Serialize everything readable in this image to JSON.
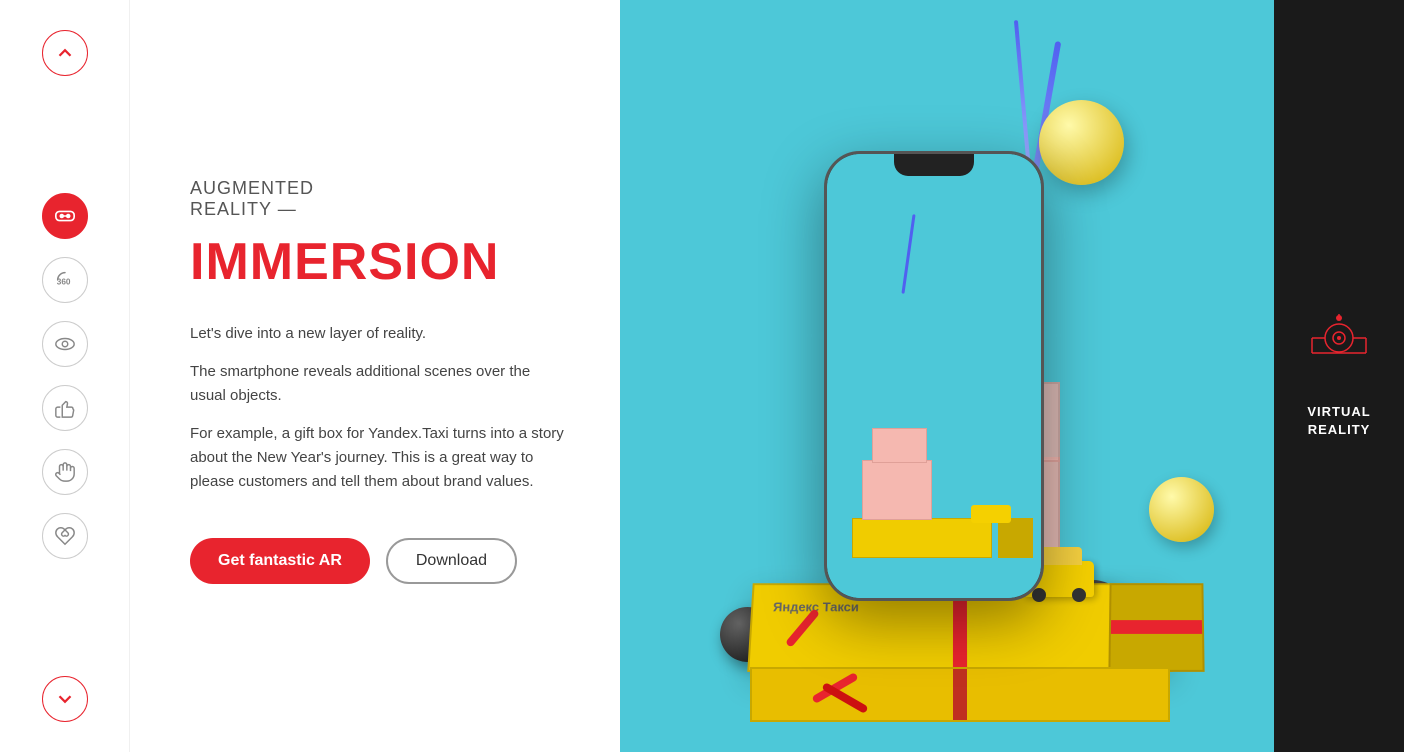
{
  "sidebar": {
    "up_arrow": "↑",
    "down_arrow": "↓",
    "icons": [
      {
        "name": "vr-goggles-icon",
        "label": "VR Goggles",
        "active": true
      },
      {
        "name": "360-icon",
        "label": "360"
      },
      {
        "name": "eye-icon",
        "label": "Eye"
      },
      {
        "name": "thumb-up-icon",
        "label": "Thumbs Up"
      },
      {
        "name": "hand-icon",
        "label": "Hand"
      },
      {
        "name": "handshake-icon",
        "label": "Handshake"
      }
    ]
  },
  "content": {
    "subtitle": "AUGMENTED\nREALITY —",
    "title": "IMMERSION",
    "description1": "Let's dive into a new layer of reality.",
    "description2": "The smartphone reveals additional scenes over the usual objects.",
    "description3": "For example, a gift box for Yandex.Taxi turns into a story about the New Year's journey. This is a great way to please customers and tell them about brand values.",
    "btn_primary": "Get fantastic AR",
    "btn_secondary": "Download"
  },
  "right_panel": {
    "label_line1": "VIRTUAL",
    "label_line2": "REALITY"
  },
  "colors": {
    "accent": "#e8242e",
    "bg_hero": "#4dc8d8",
    "bg_right": "#1a1a1a",
    "text_dark": "#333333",
    "text_mid": "#555555"
  }
}
